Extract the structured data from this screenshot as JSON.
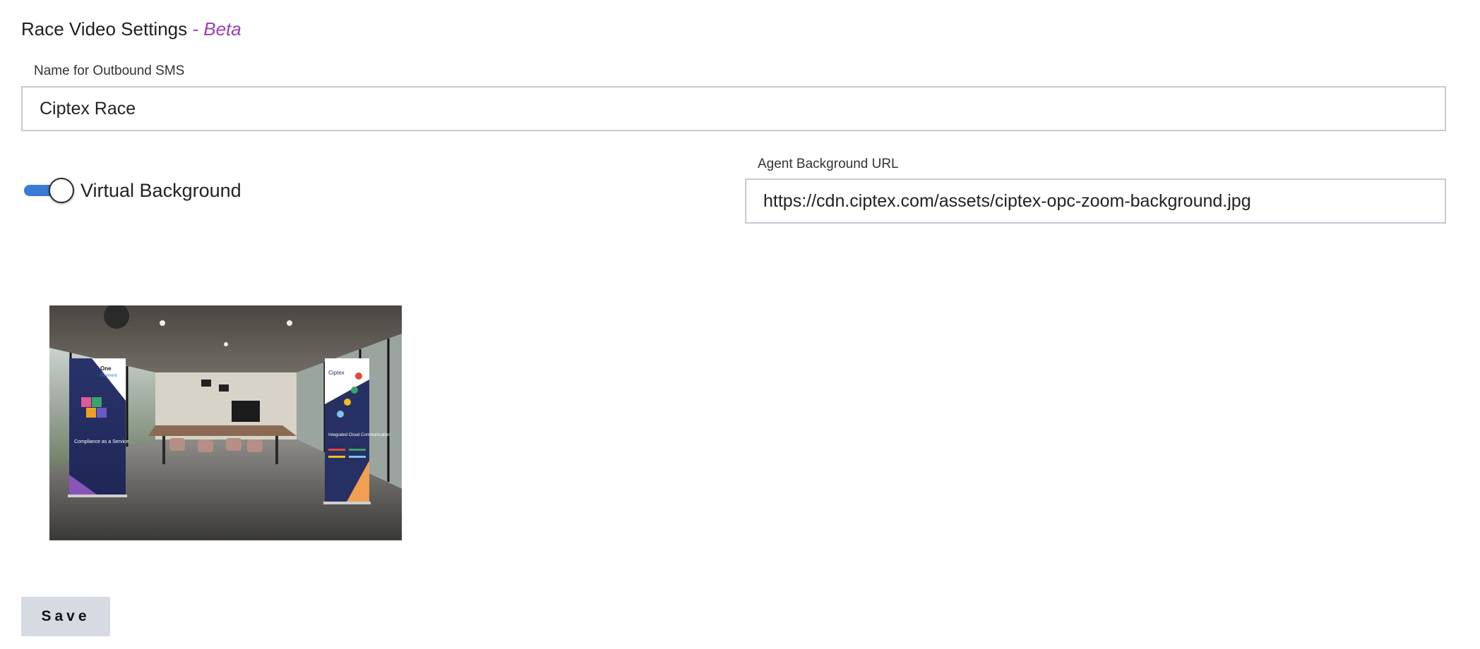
{
  "page": {
    "title": "Race Video Settings",
    "beta_tag": "- Beta"
  },
  "sms": {
    "label": "Name for Outbound SMS",
    "value": "Ciptex Race"
  },
  "virtual_background": {
    "label": "Virtual Background",
    "enabled": true
  },
  "agent_background": {
    "label": "Agent Background URL",
    "value": "https://cdn.ciptex.com/assets/ciptex-opc-zoom-background.jpg"
  },
  "preview_banners": {
    "left": {
      "headline_top": "One",
      "headline_small": "Payment",
      "headline_main": "Compliance as a Service"
    },
    "right": {
      "brand": "Ciptex",
      "headline_main": "Integrated Cloud Communication"
    }
  },
  "actions": {
    "save_label": "Save"
  },
  "colors": {
    "accent": "#3a7bd5",
    "beta": "#9b3fb8",
    "input_border": "#c7c9d4",
    "save_bg": "#d6dae3"
  }
}
